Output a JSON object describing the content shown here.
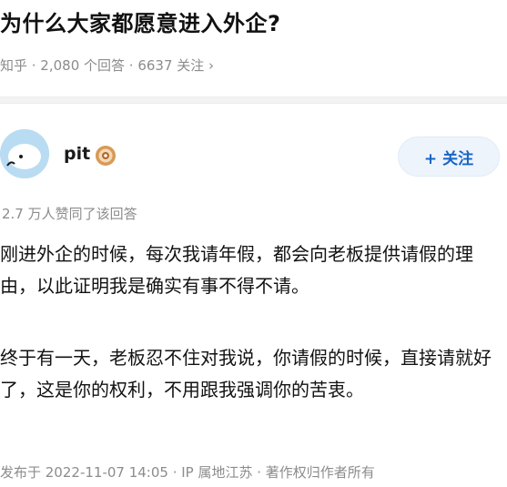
{
  "question": {
    "title": "为什么大家都愿意进入外企?",
    "meta": "知乎 · 2,080 个回答 · 6637 关注 ›"
  },
  "author": {
    "name": "pit",
    "badge_icon": "gold-badge-icon",
    "follow_label": "+ 关注"
  },
  "answer": {
    "upvotes": "2.7 万人赞同了该回答",
    "paragraphs": [
      "刚进外企的时候，每次我请年假，都会向老板提供请假的理由，以此证明我是确实有事不得不请。",
      "终于有一天，老板忍不住对我说，你请假的时候，直接请就好了，这是你的权利，不用跟我强调你的苦衷。"
    ],
    "footer": "发布于 2022-11-07 14:05 · IP 属地江苏 · 著作权归作者所有"
  },
  "colors": {
    "accent": "#1765c5",
    "muted_text": "#8c8c8c",
    "follow_bg": "#eef4fb"
  }
}
